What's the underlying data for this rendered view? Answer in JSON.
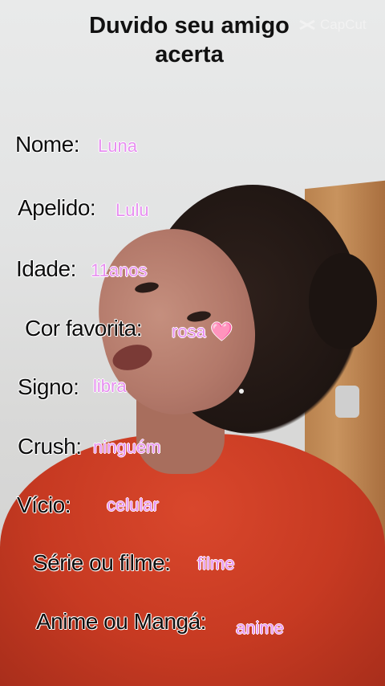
{
  "title": "Duvido seu amigo acerta",
  "watermark": "CapCut",
  "fields": [
    {
      "label": "Nome:",
      "value": "Luna"
    },
    {
      "label": "Apelido:",
      "value": "Lulu"
    },
    {
      "label": "Idade:",
      "value": "11anos"
    },
    {
      "label": "Cor favorita:",
      "value": "rosa",
      "emoji": "🩷"
    },
    {
      "label": "Signo:",
      "value": "libra"
    },
    {
      "label": "Crush:",
      "value": "ninguém"
    },
    {
      "label": "Vício:",
      "value": "celular"
    },
    {
      "label": "Série ou filme:",
      "value": "filme"
    },
    {
      "label": "Anime ou Mangá:",
      "value": "anime"
    }
  ],
  "colors": {
    "label": "#0d0d0d",
    "value": "#e78ff0",
    "shirt": "#d9472c"
  }
}
